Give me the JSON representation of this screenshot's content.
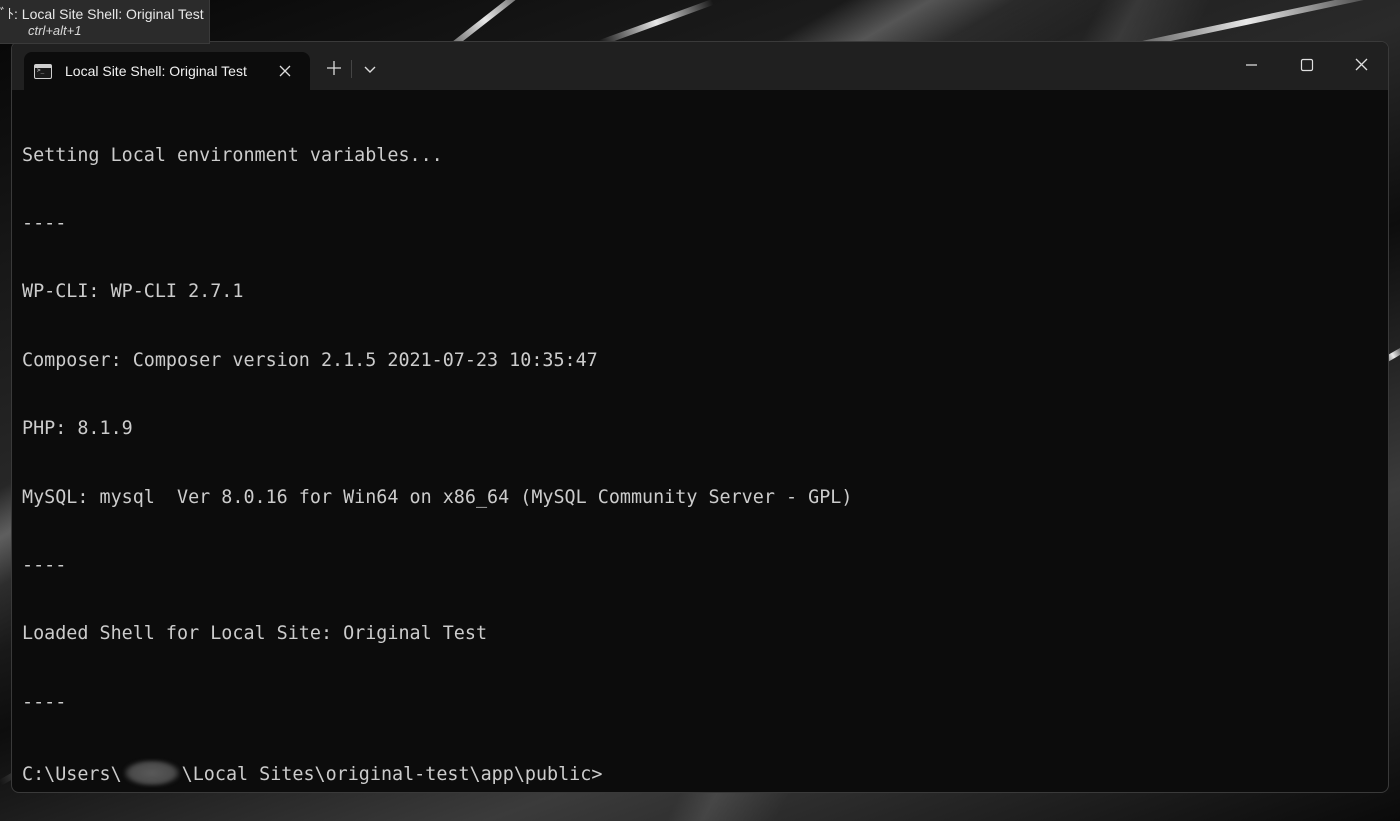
{
  "tooltip": {
    "title": "ﾞﾄ: Local Site Shell: Original Test",
    "shortcut": "ctrl+alt+1"
  },
  "window": {
    "tab": {
      "title": "Local Site Shell: Original Test",
      "icon": "terminal-icon",
      "close_icon": "close-icon"
    },
    "new_tab_icon": "plus-icon",
    "dropdown_icon": "chevron-down-icon",
    "controls": {
      "minimize_icon": "minimize-icon",
      "maximize_icon": "maximize-icon",
      "close_icon": "close-icon"
    }
  },
  "terminal": {
    "lines": [
      "Setting Local environment variables...",
      "----",
      "WP-CLI: WP-CLI 2.7.1",
      "Composer: Composer version 2.1.5 2021-07-23 10:35:47",
      "PHP: 8.1.9",
      "MySQL: mysql  Ver 8.0.16 for Win64 on x86_64 (MySQL Community Server - GPL)",
      "----",
      "Loaded Shell for Local Site: Original Test",
      "----"
    ],
    "prompt_prefix": "C:\\Users\\",
    "prompt_suffix": "\\Local Sites\\original-test\\app\\public>"
  },
  "colors": {
    "terminal_bg": "#0c0c0c",
    "titlebar_bg": "#202020",
    "text": "#cccccc"
  }
}
